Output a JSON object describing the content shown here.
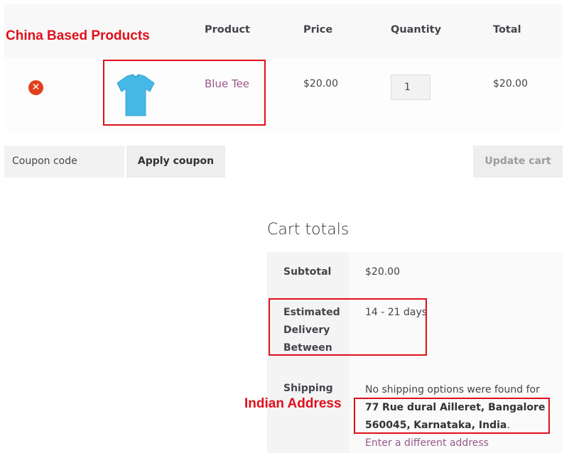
{
  "annotations": {
    "china_label": "China Based Products",
    "indian_label": "Indian Address"
  },
  "cart_table": {
    "headers": {
      "product": "Product",
      "price": "Price",
      "quantity": "Quantity",
      "total": "Total"
    },
    "rows": [
      {
        "product_name": "Blue Tee",
        "price": "$20.00",
        "quantity": "1",
        "total": "$20.00",
        "thumbnail_icon": "blue-tshirt-icon",
        "thumbnail_color": "#45b8e6"
      }
    ]
  },
  "actions": {
    "coupon_placeholder": "Coupon code",
    "apply_coupon": "Apply coupon",
    "update_cart": "Update cart"
  },
  "cart_totals": {
    "title": "Cart totals",
    "subtotal_label": "Subtotal",
    "subtotal_value": "$20.00",
    "delivery_label_line1": "Estimated",
    "delivery_label_line2": "Delivery",
    "delivery_label_line3": "Between",
    "delivery_value": "14 - 21 days",
    "shipping_label": "Shipping",
    "shipping_text": "No shipping options were found for",
    "shipping_address_part1": "77",
    "shipping_address_part2": "Rue dural Ailleret, Bangalore 560045,",
    "shipping_address_part3": "Karnataka, India",
    "shipping_period": ".",
    "change_address": "Enter a different address"
  },
  "colors": {
    "accent_link": "#96588a",
    "remove_icon": "#e2401c",
    "highlight_red": "#e0101a"
  }
}
